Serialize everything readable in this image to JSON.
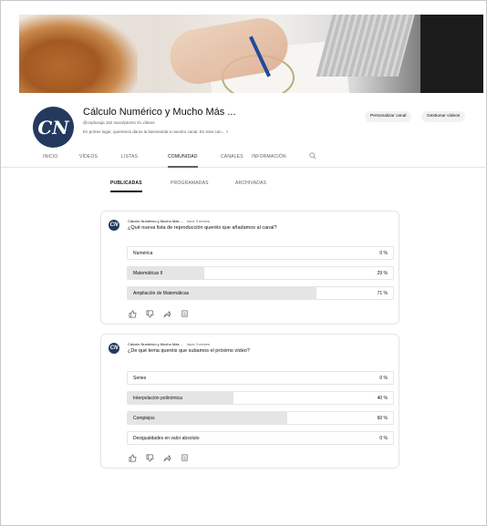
{
  "channel": {
    "name": "Cálculo Numérico y Mucho Más ...",
    "handle_meta": "@cnplusuja  152 suscriptores  41 vídeos",
    "description": "En primer lugar, queremos daros la bienvenida a nuestro canal. En este can...  >",
    "avatar_text": "CN",
    "buttons": {
      "customize": "Personalizar canal",
      "manage": "Gestionar vídeos"
    }
  },
  "tabs": [
    {
      "label": "INICIO"
    },
    {
      "label": "VÍDEOS"
    },
    {
      "label": "LISTAS"
    },
    {
      "label": "COMUNIDAD",
      "active": true
    },
    {
      "label": "CANALES"
    },
    {
      "label": "INFORMACIÓN"
    }
  ],
  "subtabs": [
    {
      "label": "PUBLICADAS",
      "active": true
    },
    {
      "label": "PROGRAMADAS"
    },
    {
      "label": "ARCHIVADAS"
    }
  ],
  "posts": [
    {
      "author": "Cálculo Numérico y Mucho Más ...",
      "time": "hace 3 meses",
      "question": "¿Qué nueva lista de reproducción queréis que añadamos al canal?",
      "options": [
        {
          "label": "Numérica",
          "pct": "0 %",
          "fill": 0.0
        },
        {
          "label": "Matemáticas II",
          "pct": "29 %",
          "fill": 0.29
        },
        {
          "label": "Ampliación de Matemáticas",
          "pct": "71 %",
          "fill": 0.71
        }
      ]
    },
    {
      "author": "Cálculo Numérico y Mucho Más ...",
      "time": "hace 3 meses",
      "question": "¿De qué tema queréis que subamos el próximo vídeo?",
      "options": [
        {
          "label": "Series",
          "pct": "0 %",
          "fill": 0.0
        },
        {
          "label": "Interpolación polinómica",
          "pct": "40 %",
          "fill": 0.4
        },
        {
          "label": "Complejos",
          "pct": "60 %",
          "fill": 0.6
        },
        {
          "label": "Desigualdades en valor absoluto",
          "pct": "0 %",
          "fill": 0.0
        }
      ]
    }
  ],
  "colors": {
    "accent": "#233a5e",
    "bar_fill": "#e5e5e5",
    "muted": "#606060"
  },
  "icons": [
    "like-icon",
    "dislike-icon",
    "share-icon",
    "comment-icon",
    "search-icon"
  ]
}
